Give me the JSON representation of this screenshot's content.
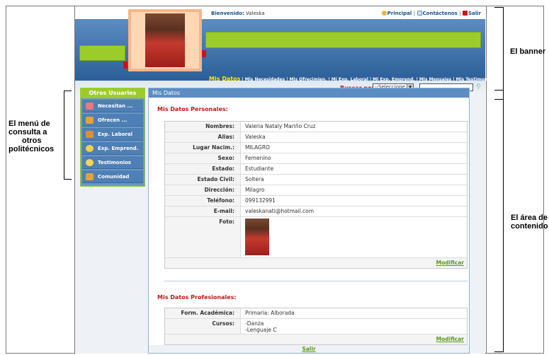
{
  "annotations": {
    "banner": "El banner",
    "menu": [
      "El menú de",
      "consulta a",
      "otros",
      "politécnicos"
    ],
    "content": [
      "El área de",
      "contenido"
    ]
  },
  "header": {
    "welcome_label": "Bienvenido:",
    "welcome_user": "Valeska",
    "links": [
      "Principal",
      "Contáctenos",
      "Salir"
    ]
  },
  "nav": {
    "items": [
      "Mis Datos",
      "Mis Necesidades",
      "Mis Ofrecimien.",
      "Mi Exp. Laboral",
      "Mi Exp. Emprend.",
      "Mis Mensajes",
      "Mis Testimonios"
    ]
  },
  "search": {
    "label": "Buscar por:",
    "select_value": "--Seleccione",
    "input_value": ""
  },
  "sidebar": {
    "title": "Otros Usuarios",
    "items": [
      {
        "label": "Necesitan ...",
        "icon": "people-icon",
        "color": "#e77"
      },
      {
        "label": "Ofrecen ...",
        "icon": "people-icon",
        "color": "#e6a13a"
      },
      {
        "label": "Exp. Laboral",
        "icon": "folder-icon",
        "color": "#d9903b"
      },
      {
        "label": "Exp. Emprend.",
        "icon": "bulb-icon",
        "color": "#f3d04a"
      },
      {
        "label": "Testimonios",
        "icon": "speech-icon",
        "color": "#f6d45a"
      },
      {
        "label": "Comunidad",
        "icon": "people-icon",
        "color": "#e6a13a"
      }
    ]
  },
  "content": {
    "header": "Mis Datos",
    "personal_title": "Mis Datos Personales:",
    "personal": [
      {
        "k": "Nombres:",
        "v": "Valeria Nataly Mariño Cruz"
      },
      {
        "k": "Alias:",
        "v": "Valeska"
      },
      {
        "k": "Lugar Nacim.:",
        "v": "MILAGRO"
      },
      {
        "k": "Sexo:",
        "v": "Femenino"
      },
      {
        "k": "Estado:",
        "v": "Estudiante"
      },
      {
        "k": "Estado Civil:",
        "v": "Soltera"
      },
      {
        "k": "Dirección:",
        "v": "Milagro"
      },
      {
        "k": "Teléfono:",
        "v": "099132991"
      },
      {
        "k": "E-mail:",
        "v": "valeskanati@hotmail.com"
      }
    ],
    "photo_label": "Foto:",
    "modify_label": "Modificar",
    "professional_title": "Mis Datos Profesionales:",
    "professional": [
      {
        "k": "Form. Académica:",
        "v": "Primaria: Alborada"
      },
      {
        "k": "Cursos:",
        "v": "-Danza\n-Lenguaje C"
      }
    ],
    "exit_label": "Salir"
  }
}
